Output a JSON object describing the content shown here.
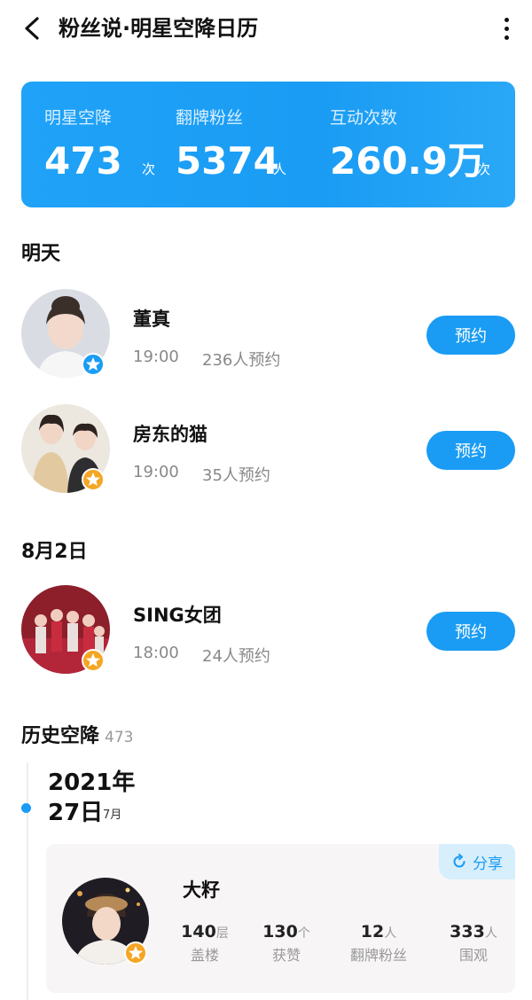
{
  "header": {
    "title": "粉丝说·明星空降日历"
  },
  "stats": [
    {
      "label": "明星空降",
      "value": "473",
      "unit": "次"
    },
    {
      "label": "翻牌粉丝",
      "value": "5374",
      "unit": "人"
    },
    {
      "label": "互动次数",
      "value": "260.9万",
      "unit": "次"
    }
  ],
  "sections": {
    "tomorrow": "明天",
    "aug2": "8月2日",
    "history": "历史空降",
    "history_count": "473"
  },
  "schedule": [
    {
      "name": "董真",
      "time": "19:00",
      "count": "236人预约",
      "button": "预约",
      "badge": "blue"
    },
    {
      "name": "房东的猫",
      "time": "19:00",
      "count": "35人预约",
      "button": "预约",
      "badge": "orange"
    },
    {
      "name": "SING女团",
      "time": "18:00",
      "count": "24人预约",
      "button": "预约",
      "badge": "orange"
    }
  ],
  "history": {
    "year": "2021年",
    "day": "27日",
    "month": "7月",
    "share": "分享",
    "name": "大籽",
    "metrics": [
      {
        "value": "140",
        "unit": "层",
        "label": "盖楼"
      },
      {
        "value": "130",
        "unit": "个",
        "label": "获赞"
      },
      {
        "value": "12",
        "unit": "人",
        "label": "翻牌粉丝"
      },
      {
        "value": "333",
        "unit": "人",
        "label": "围观"
      }
    ]
  },
  "colors": {
    "accent": "#1a9cf4",
    "badge_blue": "#1a9cf4",
    "badge_orange": "#f5a623"
  },
  "icons": [
    "back-arrow-icon",
    "more-vertical-icon",
    "star-badge-icon",
    "share-icon"
  ]
}
